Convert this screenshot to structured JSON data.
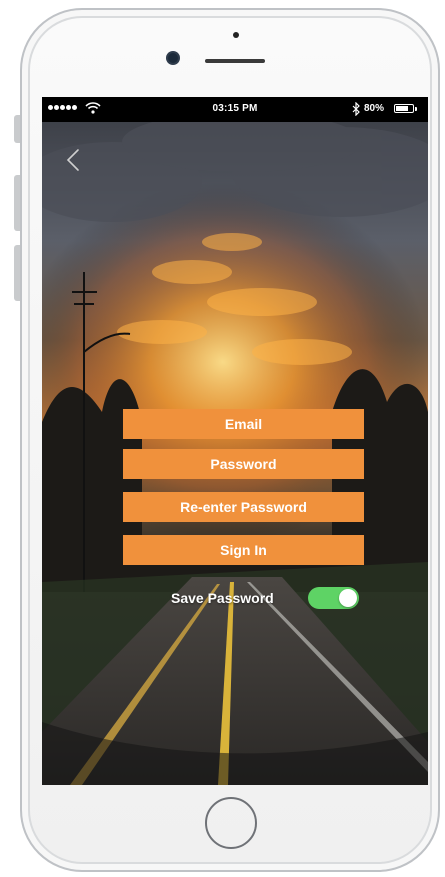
{
  "status_bar": {
    "time": "03:15 PM",
    "battery_percent": "80%",
    "battery_level": 0.8,
    "signal_icon": "signal-dots-icon",
    "wifi_icon": "wifi-icon",
    "bluetooth_icon": "bluetooth-icon"
  },
  "nav": {
    "back_icon": "chevron-left-icon"
  },
  "form": {
    "email_label": "Email",
    "password_label": "Password",
    "reenter_label": "Re-enter Password",
    "signin_label": "Sign In",
    "save_password_label": "Save Password",
    "save_password_on": true
  },
  "colors": {
    "accent": "#f0913c",
    "toggle_on": "#5ed365",
    "status_bar": "#000000"
  }
}
